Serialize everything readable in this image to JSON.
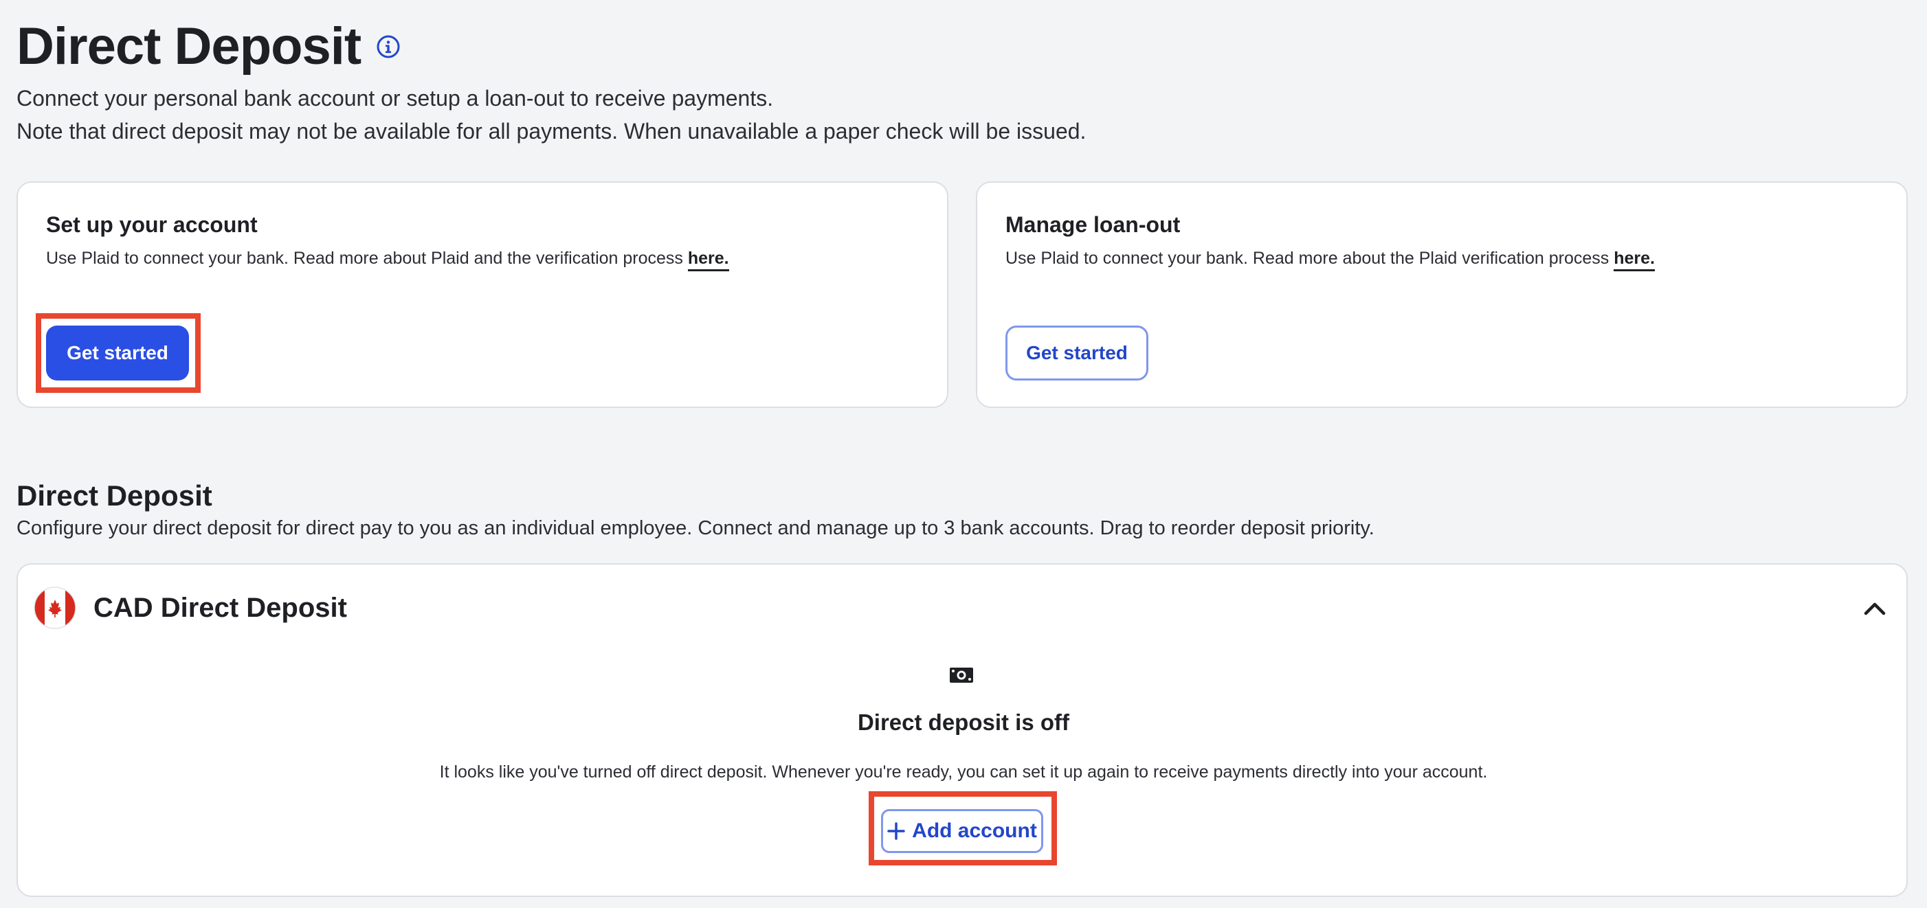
{
  "header": {
    "title": "Direct Deposit",
    "subtitle_line1": "Connect your personal bank account or setup a loan-out to receive payments.",
    "subtitle_line2": "Note that direct deposit may not be available for all payments. When unavailable a paper check will be issued."
  },
  "setup_card": {
    "title": "Set up your account",
    "description": "Use Plaid to connect your bank. Read more about Plaid and the verification process",
    "link": "here.",
    "button": "Get started"
  },
  "loan_card": {
    "title": "Manage loan-out",
    "description": "Use Plaid to connect your bank. Read more about the Plaid verification process",
    "link": "here.",
    "button": "Get started"
  },
  "section": {
    "title": "Direct Deposit",
    "description": "Configure your direct deposit for direct pay to you as an individual employee. Connect and manage up to 3 bank accounts. Drag to reorder deposit priority."
  },
  "cad_panel": {
    "title": "CAD Direct Deposit",
    "empty_title": "Direct deposit is off",
    "empty_description": "It looks like you've turned off direct deposit. Whenever you're ready, you can set it up again to receive payments directly into your account.",
    "add_button": "Add account"
  },
  "icons": {
    "info": "info-circle-icon",
    "flag": "canada-flag-icon",
    "collapse": "chevron-up-icon",
    "money": "cash-icon",
    "plus": "plus-icon"
  },
  "colors": {
    "primary": "#2a4fe4",
    "outline_border": "#7f97ec",
    "highlight": "#e8462f",
    "flag_red": "#d52b1e"
  }
}
